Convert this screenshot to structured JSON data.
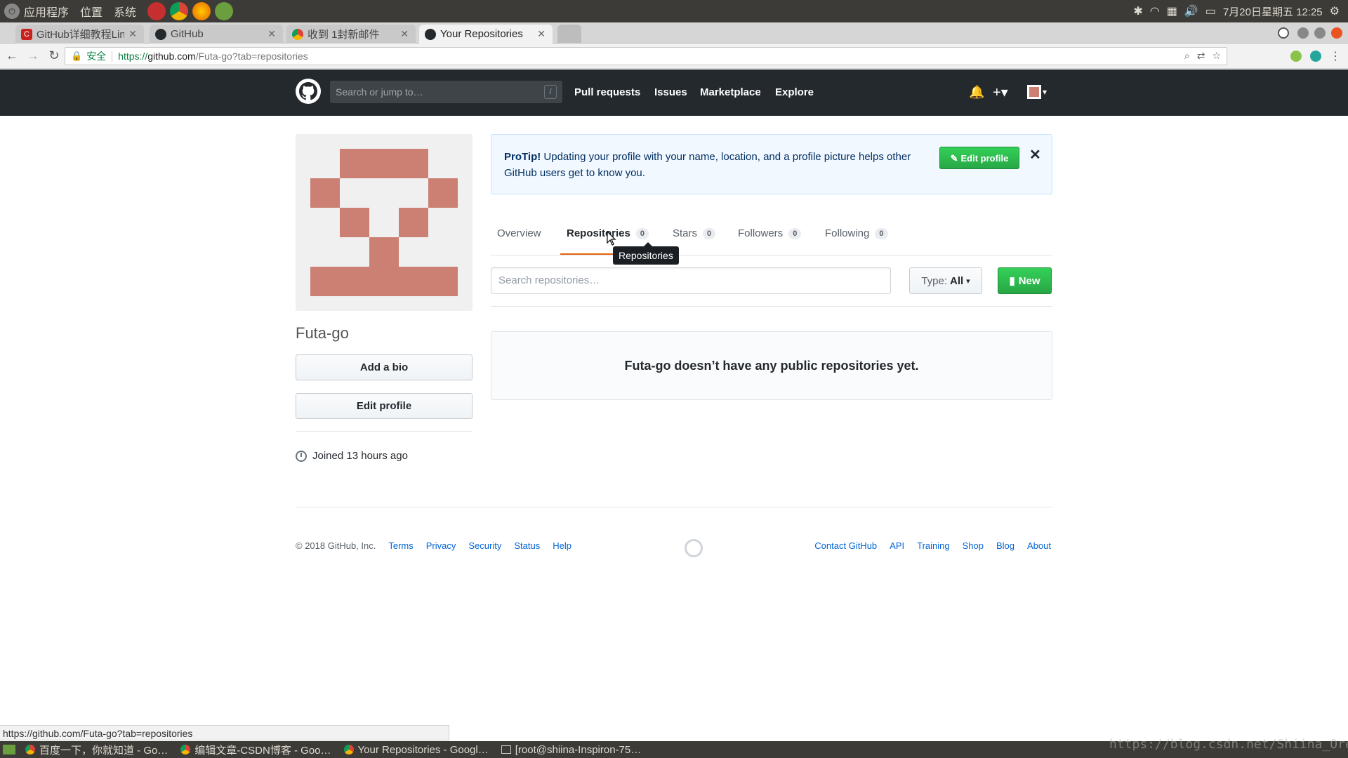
{
  "os": {
    "menus": [
      "应用程序",
      "位置",
      "系统"
    ],
    "clock": "7月20日星期五 12:25"
  },
  "browser": {
    "tabs": [
      {
        "label": "GitHub详细教程Lin",
        "icon": "csdn-icon",
        "color": "#c9211e"
      },
      {
        "label": "GitHub",
        "icon": "github-icon",
        "color": "#24292e"
      },
      {
        "label": "收到 1封新邮件",
        "icon": "mail-icon",
        "color": "#4285f4"
      },
      {
        "label": "Your Repositories",
        "icon": "github-icon",
        "color": "#24292e"
      }
    ],
    "secure_label": "安全",
    "url_scheme": "https://",
    "url_host": "github.com",
    "url_path": "/Futa-go?tab=repositories",
    "status_url": "https://github.com/Futa-go?tab=repositories"
  },
  "gh_header": {
    "search_placeholder": "Search or jump to…",
    "slash": "/",
    "nav": [
      "Pull requests",
      "Issues",
      "Marketplace",
      "Explore"
    ]
  },
  "profile": {
    "username": "Futa-go",
    "add_bio": "Add a bio",
    "edit_profile": "Edit profile",
    "joined": "Joined 13 hours ago"
  },
  "protip": {
    "lead": "ProTip!",
    "text": " Updating your profile with your name, location, and a profile picture helps other GitHub users get to know you.",
    "button": "Edit profile",
    "close": "✕"
  },
  "tabs": [
    {
      "label": "Overview",
      "count": ""
    },
    {
      "label": "Repositories",
      "count": "0"
    },
    {
      "label": "Stars",
      "count": "0"
    },
    {
      "label": "Followers",
      "count": "0"
    },
    {
      "label": "Following",
      "count": "0"
    }
  ],
  "tooltip": "Repositories",
  "repos": {
    "search_placeholder": "Search repositories…",
    "type_label": "Type:",
    "type_value": "All",
    "new_label": "New",
    "empty_message": "Futa-go doesn’t have any public repositories yet."
  },
  "footer": {
    "copyright": "© 2018 GitHub, Inc.",
    "left_links": [
      "Terms",
      "Privacy",
      "Security",
      "Status",
      "Help"
    ],
    "right_links": [
      "Contact GitHub",
      "API",
      "Training",
      "Shop",
      "Blog",
      "About"
    ]
  },
  "taskbar": {
    "items": [
      "百度一下，你就知道 - Go…",
      "编辑文章-CSDN博客 - Goo…",
      "Your Repositories - Googl…",
      "[root@shiina-Inspiron-75…"
    ]
  },
  "watermark": "https://blog.csdn.net/Shiina_Orez",
  "colors": {
    "accent_green": "#28a745",
    "tab_underline": "#e36209",
    "identicon": "#cc8073",
    "link": "#0366d6"
  }
}
